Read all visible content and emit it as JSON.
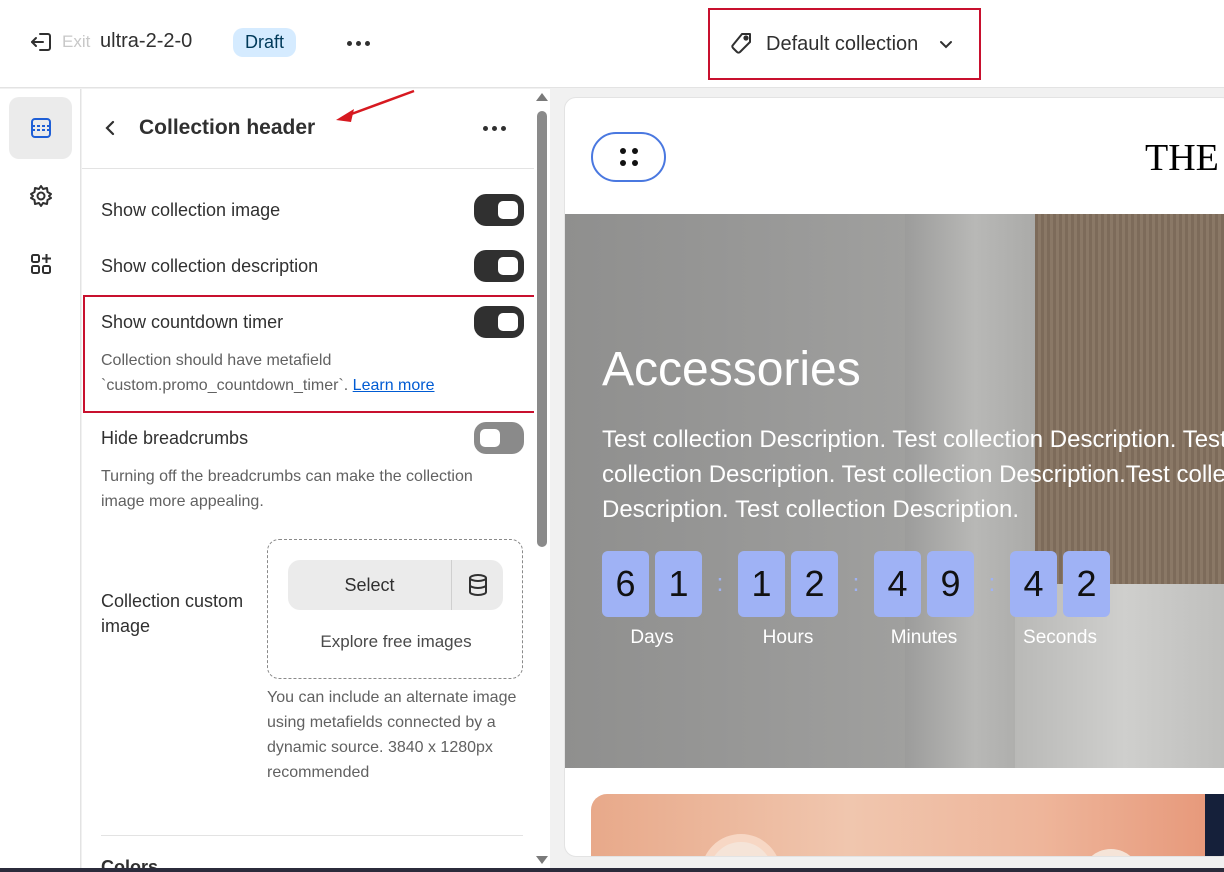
{
  "topbar": {
    "exit_label": "Exit",
    "theme_name": "ultra-2-2-0",
    "status_badge": "Draft",
    "template_selector": "Default collection"
  },
  "panel": {
    "title": "Collection header",
    "settings": [
      {
        "label": "Show collection image",
        "enabled": true
      },
      {
        "label": "Show collection description",
        "enabled": true
      },
      {
        "label": "Show countdown timer",
        "enabled": true
      },
      {
        "label": "Hide breadcrumbs",
        "enabled": false
      }
    ],
    "countdown_help": "Collection should have metafield `custom.promo_countdown_timer`.",
    "countdown_help_link": "Learn more",
    "breadcrumbs_help": "Turning off the breadcrumbs can make the collection image more appealing.",
    "custom_image_label": "Collection custom image",
    "select_button": "Select",
    "explore_link": "Explore free images",
    "custom_image_help": "You can include an alternate image using metafields connected by a dynamic source. 3840 x 1280px recommended",
    "next_section_label": "Colors"
  },
  "preview": {
    "store_logo": "THE I",
    "collection_title": "Accessories",
    "collection_description": "Test collection Description. Test collection Description. Test collection Description. Test collection Description.Test collection Description. Test collection Description.",
    "countdown": [
      {
        "digits": [
          "6",
          "1"
        ],
        "label": "Days"
      },
      {
        "digits": [
          "1",
          "2"
        ],
        "label": "Hours"
      },
      {
        "digits": [
          "4",
          "9"
        ],
        "label": "Minutes"
      },
      {
        "digits": [
          "4",
          "2"
        ],
        "label": "Seconds"
      }
    ],
    "countdown_separator": ":"
  },
  "colors": {
    "accent_annotation": "#c8102e",
    "digit_box": "#9fb2f5",
    "draft_badge": "#d5ebff",
    "link": "#005bd3"
  }
}
